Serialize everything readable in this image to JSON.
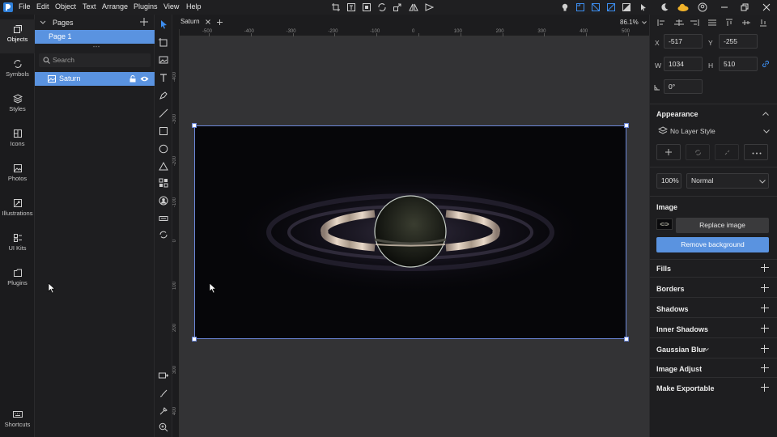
{
  "menubar": {
    "items": [
      "File",
      "Edit",
      "Object",
      "Text",
      "Arrange",
      "Plugins",
      "View",
      "Help"
    ]
  },
  "left_rail": {
    "items": [
      {
        "label": "Objects",
        "icon": "objects-icon"
      },
      {
        "label": "Symbols",
        "icon": "symbols-icon"
      },
      {
        "label": "Styles",
        "icon": "styles-icon"
      },
      {
        "label": "Icons",
        "icon": "icons-icon"
      },
      {
        "label": "Photos",
        "icon": "photos-icon"
      },
      {
        "label": "Illustrations",
        "icon": "illustrations-icon"
      },
      {
        "label": "UI Kits",
        "icon": "ui-kits-icon"
      },
      {
        "label": "Plugins",
        "icon": "plugins-icon"
      }
    ],
    "shortcuts_label": "Shortcuts"
  },
  "layers": {
    "pages_label": "Pages",
    "page": "Page 1",
    "search_placeholder": "Search",
    "layer": "Saturn"
  },
  "document": {
    "tab": "Saturn",
    "zoom": "86.1%"
  },
  "rulers": {
    "horizontal": [
      "-500",
      "-400",
      "-300",
      "-200",
      "-100",
      "0",
      "100",
      "200",
      "300",
      "400",
      "500"
    ],
    "vertical": [
      "-400",
      "-300",
      "-200",
      "-100",
      "0",
      "100",
      "200",
      "300",
      "400"
    ]
  },
  "properties": {
    "x_label": "X",
    "x": "-517",
    "y_label": "Y",
    "y": "-255",
    "w_label": "W",
    "w": "1034",
    "h_label": "H",
    "h": "510",
    "rotation": "0°",
    "appearance_title": "Appearance",
    "layer_style": "No Layer Style",
    "opacity": "100%",
    "blend_mode": "Normal",
    "image_title": "Image",
    "replace_image": "Replace image",
    "remove_background": "Remove background",
    "sections": [
      "Fills",
      "Borders",
      "Shadows",
      "Inner Shadows",
      "Gaussian Blur",
      "Image Adjust",
      "Make Exportable"
    ]
  },
  "colors": {
    "accent": "#5a93e0",
    "selection": "#6b86d8",
    "canvas": "#333335",
    "panel": "#1e1e20"
  }
}
